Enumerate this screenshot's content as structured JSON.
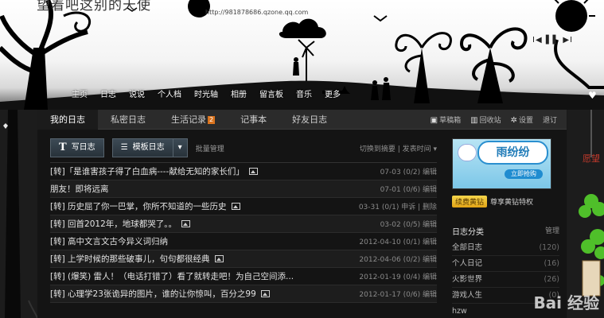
{
  "banner": {
    "site_title": "望着吧这别的天使",
    "site_url": "http://981878686.qzone.qq.com",
    "music_controls": "I◀ ▌▌ ▶I",
    "nav": [
      "主页",
      "日志",
      "说说",
      "个人档",
      "时光轴",
      "相册",
      "留言板",
      "音乐",
      "更多"
    ]
  },
  "tabs": {
    "items": [
      "我的日志",
      "私密日志",
      "生活记录",
      "记事本",
      "好友日志"
    ],
    "badge": "2",
    "tools": [
      "草稿箱",
      "回收站",
      "设置",
      "退订"
    ],
    "tool_icons": [
      "drafts-icon",
      "trash-icon",
      "gear-icon"
    ]
  },
  "toolbar": {
    "write": "写日志",
    "write_icon": "T",
    "template": "模板日志",
    "manage": "批量管理",
    "view_mode": "切换到摘要",
    "sort": "发表时间"
  },
  "posts": [
    {
      "title": "[转]「是谁害孩子得了白血病----献给无知的家长们」",
      "has_image": true,
      "date": "07-03",
      "count": "(0/2)",
      "action": "编辑"
    },
    {
      "title": "朋友！即将远离",
      "has_image": false,
      "date": "07-01",
      "count": "(0/6)",
      "action": "编辑"
    },
    {
      "title": "[转] 历史屈了你一巴掌，你所不知道的一些历史",
      "has_image": true,
      "date": "03-31",
      "count": "(0/1)",
      "action": "申诉 | 删除"
    },
    {
      "title": "[转] 回首2012年，地球都哭了。。",
      "has_image": true,
      "date": "03-02",
      "count": "(0/5)",
      "action": "编辑"
    },
    {
      "title": "[转] 高中文言文古今异义词归纳",
      "has_image": false,
      "date": "2012-04-10",
      "count": "(0/1)",
      "action": "编辑"
    },
    {
      "title": "[转] 上学时候的那些破事儿，句句都很经典",
      "has_image": true,
      "date": "2012-04-06",
      "count": "(0/2)",
      "action": "编辑"
    },
    {
      "title": "[转] (爆笑) 雷人！（电话打错了）看了就转走吧！为自己空间添...",
      "has_image": false,
      "date": "2012-01-19",
      "count": "(0/4)",
      "action": "编辑"
    },
    {
      "title": "[转] 心理学23张诡异的图片，谁的让你惊叫，百分之99",
      "has_image": true,
      "date": "2012-01-17",
      "count": "(0/6)",
      "action": "编辑"
    }
  ],
  "sidebar": {
    "ad_title": "雨纷纷",
    "ad_cta": "立即抢购",
    "vip_button": "续费黄钻",
    "vip_text": "尊享黄钻特权",
    "category_title": "日志分类",
    "category_manage": "管理",
    "categories": [
      {
        "name": "全部日志",
        "count": "(120)"
      },
      {
        "name": "个人日记",
        "count": "(16)"
      },
      {
        "name": "火影世界",
        "count": "(26)"
      },
      {
        "name": "游戏人生",
        "count": "(0)"
      },
      {
        "name": "hzw",
        "count": ""
      }
    ]
  },
  "deco": {
    "wish_text": "愿望",
    "watermark": "Bai 经验"
  },
  "colors": {
    "panel_bg": "#141414",
    "tab_bar": "#2b2b2b",
    "badge": "#d9731e",
    "vip_gold": "#e1a316",
    "clover": "#4fbf2a"
  }
}
